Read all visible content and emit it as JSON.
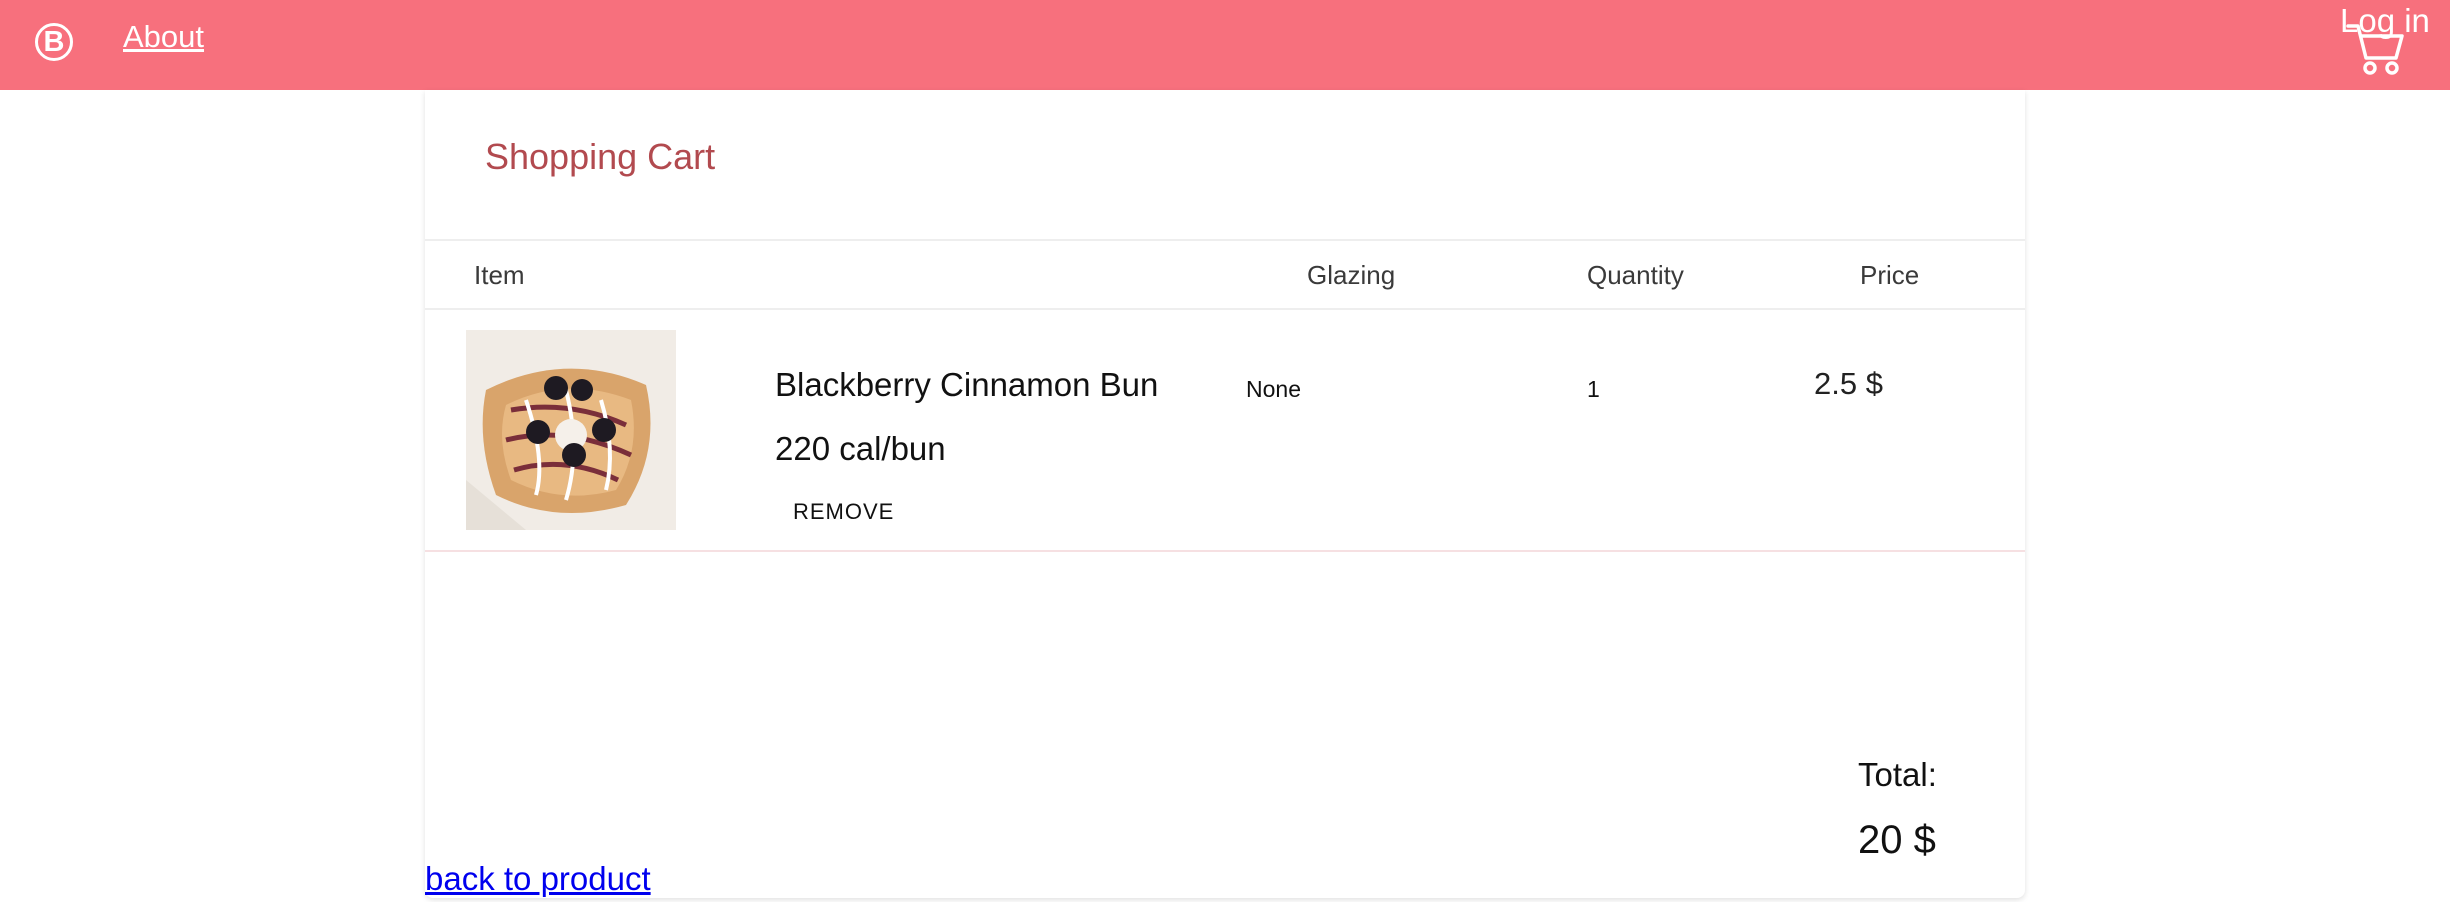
{
  "header": {
    "logo_letter": "B",
    "about_label": "About",
    "login_label": "Log in",
    "cart_icon": "shopping-cart-icon",
    "bg_color": "#f7707d"
  },
  "cart": {
    "title": "Shopping Cart",
    "columns": {
      "item": "Item",
      "glazing": "Glazing",
      "quantity": "Quantity",
      "price": "Price"
    },
    "items": [
      {
        "name": "Blackberry Cinnamon Bun",
        "calories": "220 cal/bun",
        "glazing": "None",
        "quantity": "1",
        "price": "2.5 $",
        "remove_label": "REMOVE"
      }
    ],
    "total_label": "Total:",
    "total_value": "20 $"
  },
  "back_link": "back to product",
  "colors": {
    "title": "#b24a4f",
    "link": "#0000ee"
  }
}
